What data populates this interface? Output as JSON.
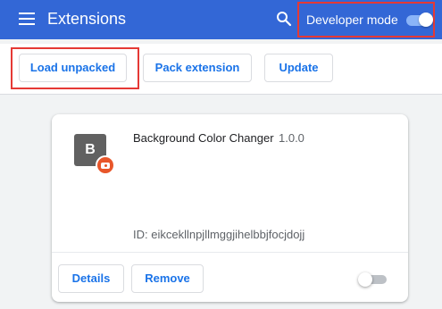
{
  "header": {
    "title": "Extensions",
    "search_icon": "search-icon",
    "menu_icon": "hamburger-menu-icon",
    "developer_mode_label": "Developer mode",
    "developer_mode_on": true,
    "color": "#3367d6"
  },
  "toolbar": {
    "load_unpacked_label": "Load unpacked",
    "pack_extension_label": "Pack extension",
    "update_label": "Update"
  },
  "extension": {
    "icon_letter": "B",
    "name": "Background Color Changer",
    "version": "1.0.0",
    "id_text": "ID: eikcekllnpjllmggjihelbbjfocjdojj",
    "details_label": "Details",
    "remove_label": "Remove",
    "enabled": false
  },
  "highlight_color": "#e53935"
}
